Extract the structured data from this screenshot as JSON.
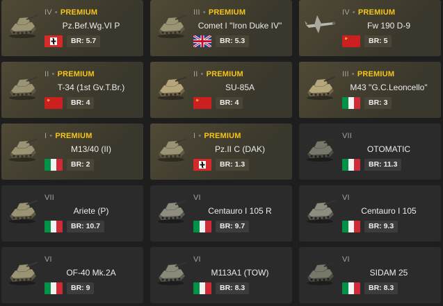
{
  "cards": [
    {
      "tier": "IV",
      "premium_label": "PREMIUM",
      "premium": true,
      "name": "Pz.Bef.Wg.VI P",
      "nation": "germany",
      "flag_icon": "germany-flag-icon",
      "vehicle_icon": "tank-icon",
      "br": "BR: 5.7"
    },
    {
      "tier": "III",
      "premium_label": "PREMIUM",
      "premium": true,
      "name": "Comet I \"Iron Duke IV\"",
      "nation": "uk",
      "flag_icon": "uk-flag-icon",
      "vehicle_icon": "tank-icon",
      "br": "BR: 5.3"
    },
    {
      "tier": "IV",
      "premium_label": "PREMIUM",
      "premium": true,
      "name": "Fw 190 D-9",
      "nation": "ussr",
      "flag_icon": "ussr-flag-icon",
      "vehicle_icon": "fighter-plane-icon",
      "br": "BR: 5"
    },
    {
      "tier": "II",
      "premium_label": "PREMIUM",
      "premium": true,
      "name": "T-34 (1st Gv.T.Br.)",
      "nation": "ussr",
      "flag_icon": "ussr-flag-icon",
      "vehicle_icon": "tank-icon",
      "br": "BR: 4"
    },
    {
      "tier": "II",
      "premium_label": "PREMIUM",
      "premium": true,
      "name": "SU-85A",
      "nation": "ussr",
      "flag_icon": "ussr-flag-icon",
      "vehicle_icon": "tank-destroyer-icon",
      "br": "BR: 4"
    },
    {
      "tier": "III",
      "premium_label": "PREMIUM",
      "premium": true,
      "name": "M43 \"G.C.Leoncello\"",
      "nation": "italy",
      "flag_icon": "italy-flag-icon",
      "vehicle_icon": "tank-destroyer-icon",
      "br": "BR: 3"
    },
    {
      "tier": "I",
      "premium_label": "PREMIUM",
      "premium": true,
      "name": "M13/40 (II)",
      "nation": "italy",
      "flag_icon": "italy-flag-icon",
      "vehicle_icon": "tank-icon",
      "br": "BR: 2"
    },
    {
      "tier": "I",
      "premium_label": "PREMIUM",
      "premium": true,
      "name": "Pz.II C (DAK)",
      "nation": "germany",
      "flag_icon": "germany-flag-icon",
      "vehicle_icon": "tank-icon",
      "br": "BR: 1.3"
    },
    {
      "tier": "VII",
      "premium_label": "",
      "premium": false,
      "name": "OTOMATIC",
      "nation": "italy",
      "flag_icon": "italy-flag-icon",
      "vehicle_icon": "spaa-icon",
      "br": "BR: 11.3"
    },
    {
      "tier": "VII",
      "premium_label": "",
      "premium": false,
      "name": "Ariete (P)",
      "nation": "italy",
      "flag_icon": "italy-flag-icon",
      "vehicle_icon": "tank-icon",
      "br": "BR: 10.7"
    },
    {
      "tier": "VI",
      "premium_label": "",
      "premium": false,
      "name": "Centauro I 105 R",
      "nation": "italy",
      "flag_icon": "italy-flag-icon",
      "vehicle_icon": "wheeled-tank-icon",
      "br": "BR: 9.7"
    },
    {
      "tier": "VI",
      "premium_label": "",
      "premium": false,
      "name": "Centauro I 105",
      "nation": "italy",
      "flag_icon": "italy-flag-icon",
      "vehicle_icon": "wheeled-tank-icon",
      "br": "BR: 9.3"
    },
    {
      "tier": "VI",
      "premium_label": "",
      "premium": false,
      "name": "OF-40 Mk.2A",
      "nation": "italy",
      "flag_icon": "italy-flag-icon",
      "vehicle_icon": "tank-icon",
      "br": "BR: 9"
    },
    {
      "tier": "VI",
      "premium_label": "",
      "premium": false,
      "name": "M113A1 (TOW)",
      "nation": "italy",
      "flag_icon": "italy-flag-icon",
      "vehicle_icon": "apc-icon",
      "br": "BR: 8.3"
    },
    {
      "tier": "VI",
      "premium_label": "",
      "premium": false,
      "name": "SIDAM 25",
      "nation": "italy",
      "flag_icon": "italy-flag-icon",
      "vehicle_icon": "spaa-icon",
      "br": "BR: 8.3"
    }
  ],
  "colors": {
    "premium_text": "#f5c518",
    "premium_card": "#3a372c",
    "regular_card": "#2b2b2b",
    "page_bg": "#1e1e1e"
  }
}
